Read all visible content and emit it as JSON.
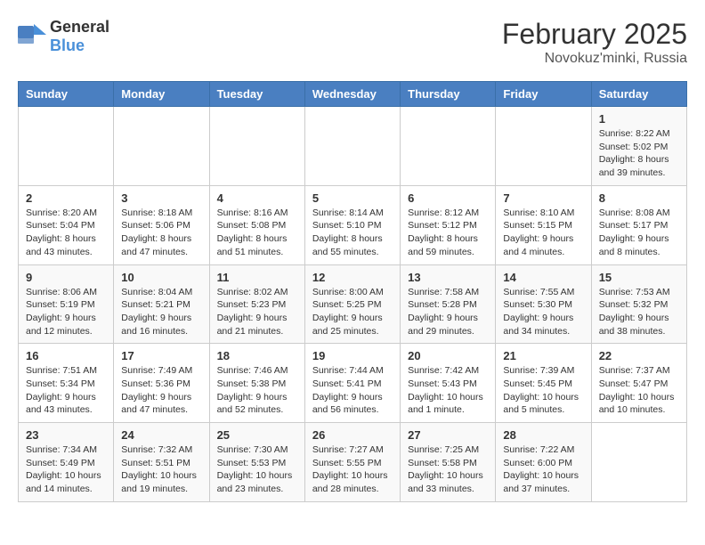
{
  "app": {
    "name_general": "General",
    "name_blue": "Blue"
  },
  "calendar": {
    "title": "February 2025",
    "subtitle": "Novokuz'minki, Russia"
  },
  "headers": [
    "Sunday",
    "Monday",
    "Tuesday",
    "Wednesday",
    "Thursday",
    "Friday",
    "Saturday"
  ],
  "weeks": [
    [
      {
        "day": "",
        "info": ""
      },
      {
        "day": "",
        "info": ""
      },
      {
        "day": "",
        "info": ""
      },
      {
        "day": "",
        "info": ""
      },
      {
        "day": "",
        "info": ""
      },
      {
        "day": "",
        "info": ""
      },
      {
        "day": "1",
        "info": "Sunrise: 8:22 AM\nSunset: 5:02 PM\nDaylight: 8 hours and 39 minutes."
      }
    ],
    [
      {
        "day": "2",
        "info": "Sunrise: 8:20 AM\nSunset: 5:04 PM\nDaylight: 8 hours and 43 minutes."
      },
      {
        "day": "3",
        "info": "Sunrise: 8:18 AM\nSunset: 5:06 PM\nDaylight: 8 hours and 47 minutes."
      },
      {
        "day": "4",
        "info": "Sunrise: 8:16 AM\nSunset: 5:08 PM\nDaylight: 8 hours and 51 minutes."
      },
      {
        "day": "5",
        "info": "Sunrise: 8:14 AM\nSunset: 5:10 PM\nDaylight: 8 hours and 55 minutes."
      },
      {
        "day": "6",
        "info": "Sunrise: 8:12 AM\nSunset: 5:12 PM\nDaylight: 8 hours and 59 minutes."
      },
      {
        "day": "7",
        "info": "Sunrise: 8:10 AM\nSunset: 5:15 PM\nDaylight: 9 hours and 4 minutes."
      },
      {
        "day": "8",
        "info": "Sunrise: 8:08 AM\nSunset: 5:17 PM\nDaylight: 9 hours and 8 minutes."
      }
    ],
    [
      {
        "day": "9",
        "info": "Sunrise: 8:06 AM\nSunset: 5:19 PM\nDaylight: 9 hours and 12 minutes."
      },
      {
        "day": "10",
        "info": "Sunrise: 8:04 AM\nSunset: 5:21 PM\nDaylight: 9 hours and 16 minutes."
      },
      {
        "day": "11",
        "info": "Sunrise: 8:02 AM\nSunset: 5:23 PM\nDaylight: 9 hours and 21 minutes."
      },
      {
        "day": "12",
        "info": "Sunrise: 8:00 AM\nSunset: 5:25 PM\nDaylight: 9 hours and 25 minutes."
      },
      {
        "day": "13",
        "info": "Sunrise: 7:58 AM\nSunset: 5:28 PM\nDaylight: 9 hours and 29 minutes."
      },
      {
        "day": "14",
        "info": "Sunrise: 7:55 AM\nSunset: 5:30 PM\nDaylight: 9 hours and 34 minutes."
      },
      {
        "day": "15",
        "info": "Sunrise: 7:53 AM\nSunset: 5:32 PM\nDaylight: 9 hours and 38 minutes."
      }
    ],
    [
      {
        "day": "16",
        "info": "Sunrise: 7:51 AM\nSunset: 5:34 PM\nDaylight: 9 hours and 43 minutes."
      },
      {
        "day": "17",
        "info": "Sunrise: 7:49 AM\nSunset: 5:36 PM\nDaylight: 9 hours and 47 minutes."
      },
      {
        "day": "18",
        "info": "Sunrise: 7:46 AM\nSunset: 5:38 PM\nDaylight: 9 hours and 52 minutes."
      },
      {
        "day": "19",
        "info": "Sunrise: 7:44 AM\nSunset: 5:41 PM\nDaylight: 9 hours and 56 minutes."
      },
      {
        "day": "20",
        "info": "Sunrise: 7:42 AM\nSunset: 5:43 PM\nDaylight: 10 hours and 1 minute."
      },
      {
        "day": "21",
        "info": "Sunrise: 7:39 AM\nSunset: 5:45 PM\nDaylight: 10 hours and 5 minutes."
      },
      {
        "day": "22",
        "info": "Sunrise: 7:37 AM\nSunset: 5:47 PM\nDaylight: 10 hours and 10 minutes."
      }
    ],
    [
      {
        "day": "23",
        "info": "Sunrise: 7:34 AM\nSunset: 5:49 PM\nDaylight: 10 hours and 14 minutes."
      },
      {
        "day": "24",
        "info": "Sunrise: 7:32 AM\nSunset: 5:51 PM\nDaylight: 10 hours and 19 minutes."
      },
      {
        "day": "25",
        "info": "Sunrise: 7:30 AM\nSunset: 5:53 PM\nDaylight: 10 hours and 23 minutes."
      },
      {
        "day": "26",
        "info": "Sunrise: 7:27 AM\nSunset: 5:55 PM\nDaylight: 10 hours and 28 minutes."
      },
      {
        "day": "27",
        "info": "Sunrise: 7:25 AM\nSunset: 5:58 PM\nDaylight: 10 hours and 33 minutes."
      },
      {
        "day": "28",
        "info": "Sunrise: 7:22 AM\nSunset: 6:00 PM\nDaylight: 10 hours and 37 minutes."
      },
      {
        "day": "",
        "info": ""
      }
    ]
  ]
}
